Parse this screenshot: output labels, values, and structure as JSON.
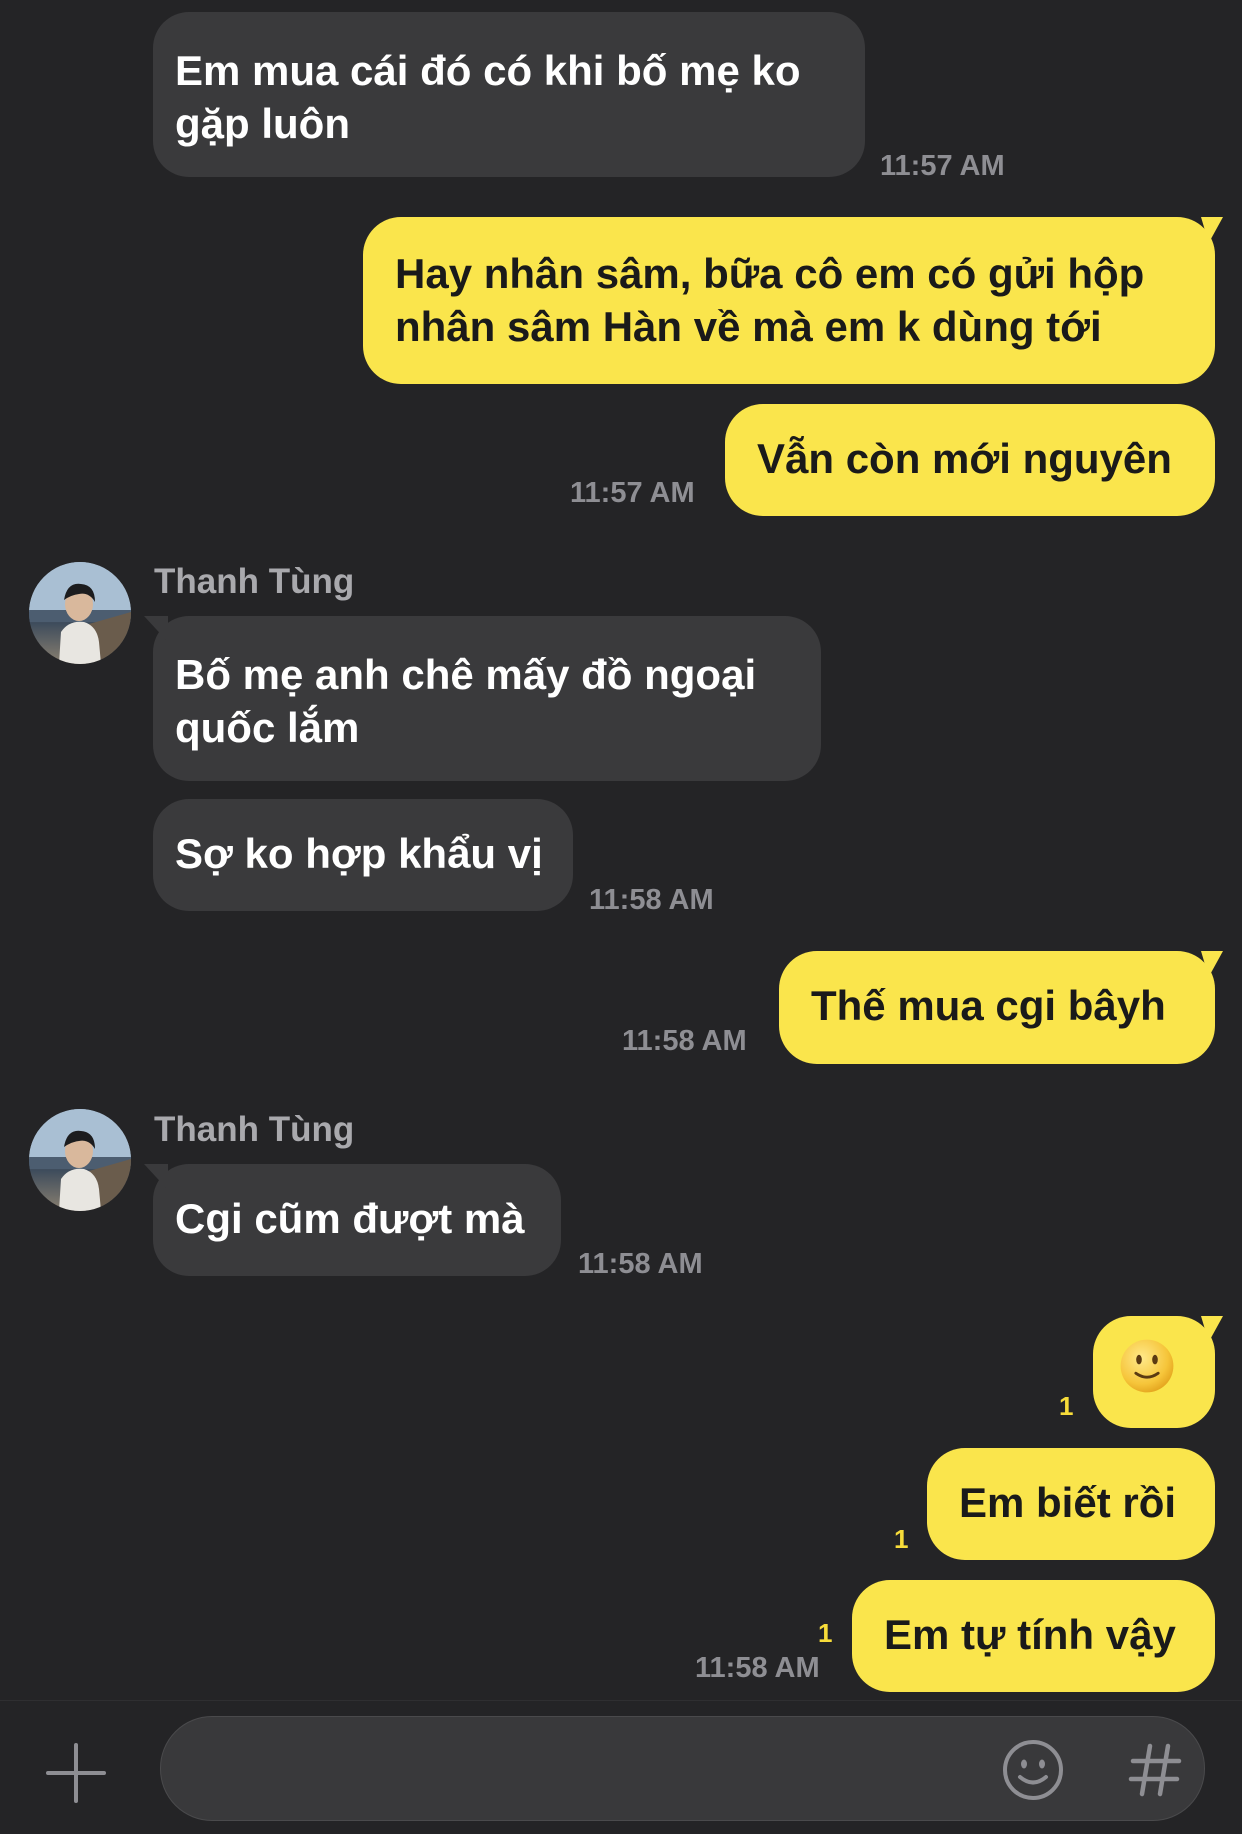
{
  "contact": {
    "name": "Thanh Tùng"
  },
  "messages": [
    {
      "from": "contact",
      "text": [
        "Em mua cái đó có khi bố mẹ ko",
        "gặp luôn"
      ],
      "time": "11:57 AM"
    },
    {
      "from": "me",
      "text": [
        "Hay nhân sâm, bữa cô em có gửi hộp",
        "nhân sâm Hàn về mà em k dùng tới"
      ]
    },
    {
      "from": "me",
      "text": "Vẫn còn mới nguyên",
      "time": "11:57 AM"
    },
    {
      "from": "contact",
      "sender": "Thanh Tùng",
      "text": [
        "Bố mẹ anh chê mấy đồ ngoại",
        "quốc lắm"
      ]
    },
    {
      "from": "contact",
      "text": "Sợ ko hợp khẩu vị",
      "time": "11:58 AM"
    },
    {
      "from": "me",
      "text": "Thế mua cgi bâyh",
      "time": "11:58 AM"
    },
    {
      "from": "contact",
      "sender": "Thanh Tùng",
      "text": "Cgi cũm đượt mà",
      "time": "11:58 AM"
    },
    {
      "from": "me",
      "emoji": "smiling-face",
      "unread": "1"
    },
    {
      "from": "me",
      "text": "Em biết rồi",
      "unread": "1"
    },
    {
      "from": "me",
      "text": "Em tự tính vậy",
      "unread": "1",
      "time": "11:58 AM"
    }
  ],
  "composer": {
    "input_value": "",
    "icons": [
      "plus-icon",
      "emoji-icon",
      "hashtag-icon"
    ]
  },
  "colors": {
    "background": "#242426",
    "incoming_bubble": "#3a3a3c",
    "outgoing_bubble": "#fae54c",
    "timestamp": "#8e8e93",
    "unread_count": "#f7dc3a"
  }
}
